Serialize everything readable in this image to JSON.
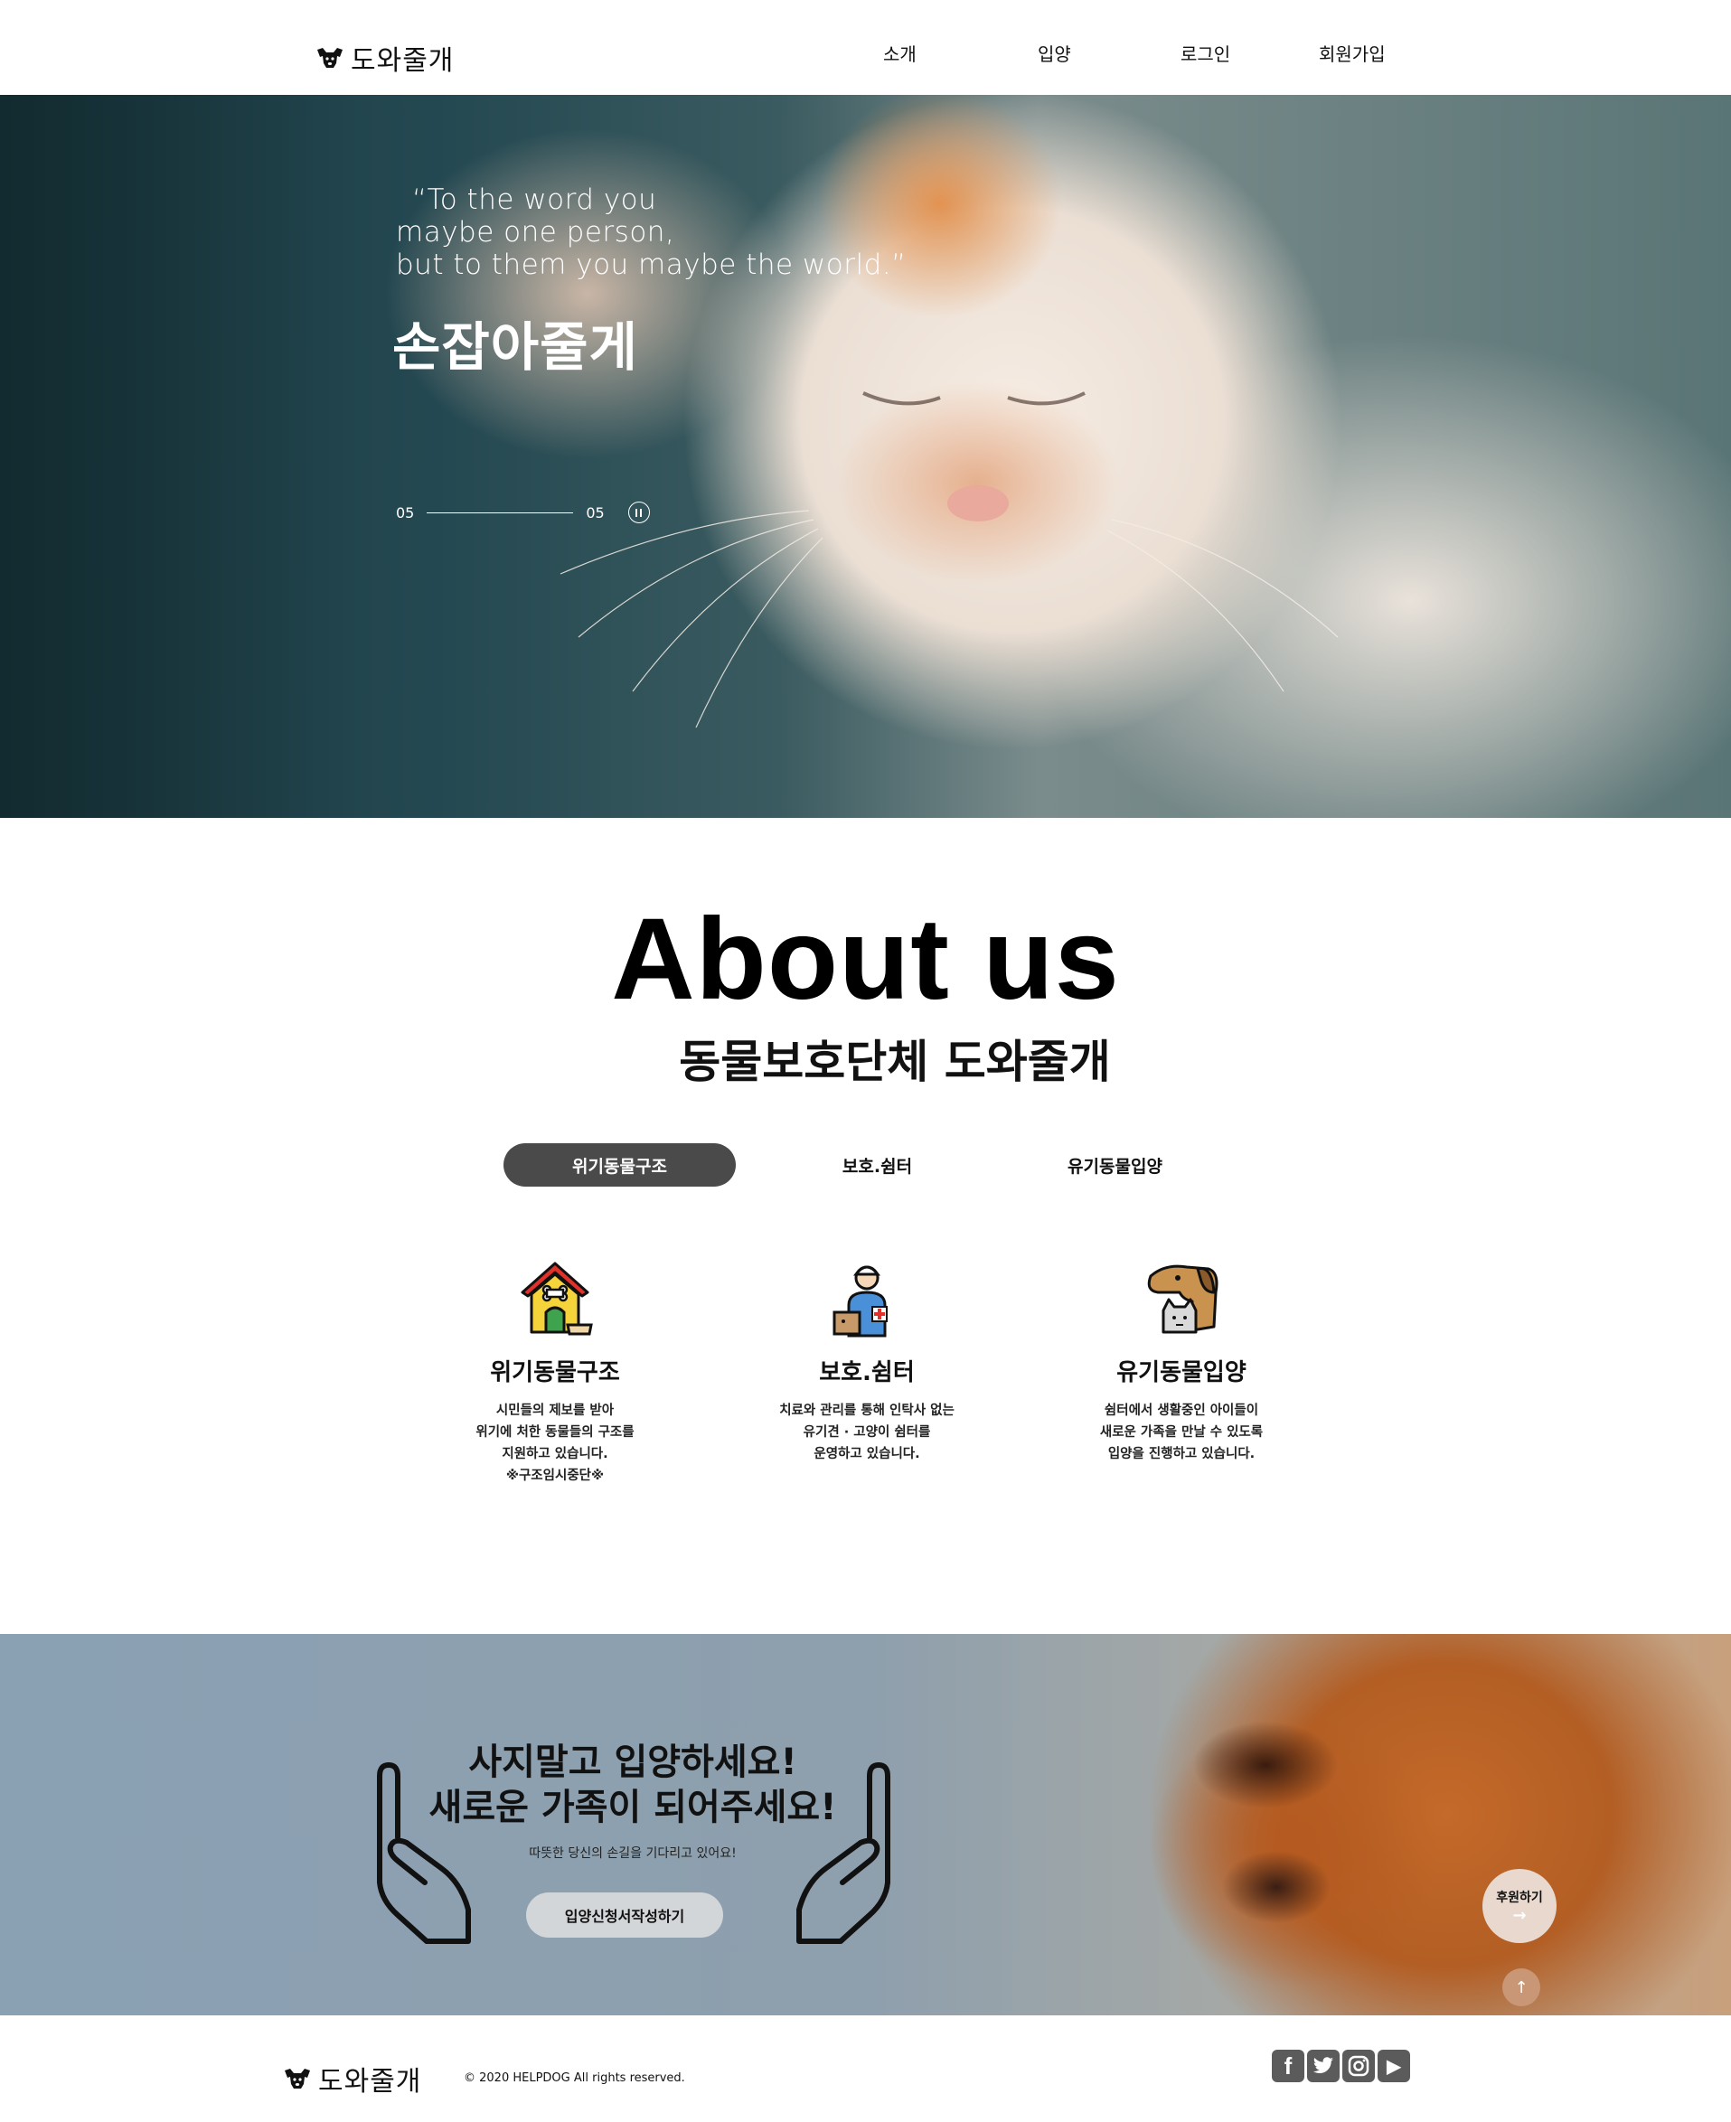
{
  "header": {
    "logo_text": "도와줄개",
    "nav": [
      "소개",
      "입양",
      "로그인",
      "회원가입"
    ]
  },
  "hero": {
    "quote_lines": [
      "“To the word you",
      "maybe one person,",
      "but to them you maybe the world.”"
    ],
    "title": "손잡아줄게",
    "slide_current": "05",
    "slide_total": "05",
    "pause_icon": "pause-icon"
  },
  "about": {
    "title": "About us",
    "subtitle": "동물보호단체 도와줄개",
    "tabs": [
      {
        "label": "위기동물구조",
        "active": true
      },
      {
        "label": "보호.쉼터",
        "active": false
      },
      {
        "label": "유기동물입양",
        "active": false
      }
    ],
    "cards": [
      {
        "icon": "doghouse-icon",
        "title": "위기동물구조",
        "lines": [
          "시민들의 제보를 받아",
          "위기에 처한 동물들의 구조를",
          "지원하고 있습니다.",
          "※구조임시중단※"
        ]
      },
      {
        "icon": "vet-icon",
        "title": "보호.쉼터",
        "lines": [
          "치료와 관리를 통해 인탁사 없는",
          "유기견 · 고양이 쉼터를",
          "운영하고 있습니다."
        ]
      },
      {
        "icon": "dog-cat-icon",
        "title": "유기동물입양",
        "lines": [
          "쉼터에서 생활중인 아이들이",
          "새로운 가족을 만날 수 있도록",
          "입양을 진행하고 있습니다."
        ]
      }
    ]
  },
  "banner": {
    "headline": [
      "사지말고 입양하세요!",
      "새로운 가족이 되어주세요!"
    ],
    "small_text": "따뜻한 당신의 손길을 기다리고 있어요!",
    "apply_button": "입양신청서작성하기",
    "donate_button": "후원하기",
    "donate_arrow": "→",
    "top_arrow": "↑"
  },
  "footer": {
    "logo_text": "도와줄개",
    "copyright": "© 2020 HELPDOG All rights reserved.",
    "social": [
      {
        "icon": "facebook-icon",
        "glyph": "f"
      },
      {
        "icon": "twitter-icon",
        "glyph": "🐦"
      },
      {
        "icon": "instagram-icon",
        "glyph": ""
      },
      {
        "icon": "youtube-icon",
        "glyph": "▶"
      }
    ]
  },
  "colors": {
    "active_tab": "#4a4a4a",
    "apply_button": "#d3d6d8",
    "donate_button": "#e9d8cd",
    "top_button": "#c99776",
    "social_icons": "#5b5b5b"
  }
}
